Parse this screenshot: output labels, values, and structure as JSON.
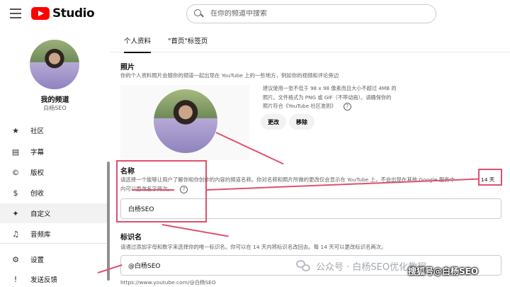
{
  "app": {
    "logo_text": "Studio"
  },
  "search": {
    "placeholder": "在你的频道中搜索"
  },
  "sidebar": {
    "channel_name": "我的频道",
    "channel_handle": "白杨SEO",
    "items": [
      {
        "label": "社区",
        "icon": "community-icon"
      },
      {
        "label": "字幕",
        "icon": "subtitles-icon"
      },
      {
        "label": "版权",
        "icon": "copyright-icon"
      },
      {
        "label": "创收",
        "icon": "monetization-icon"
      },
      {
        "label": "自定义",
        "icon": "customization-icon",
        "active": true
      },
      {
        "label": "音频库",
        "icon": "audio-library-icon"
      },
      {
        "label": "设置",
        "icon": "settings-icon"
      },
      {
        "label": "发送反馈",
        "icon": "feedback-icon"
      }
    ]
  },
  "tabs": [
    {
      "label": "个人资料",
      "active": true
    },
    {
      "label": "\"首页\"标签页",
      "active": false
    }
  ],
  "photo_section": {
    "title": "照片",
    "description": "你的个人资料照片会随你的频道一起出现在 YouTube 上的一些地方，例如你的视频和评论旁边",
    "hint_lines": [
      "建议使用一张不低于 98 x 98 像素而且大小不超过 4MB 的",
      "照片。文件格式为 PNG 或 GIF（不带动画）。请确保你的",
      "照片符合《YouTube 社区准则》"
    ],
    "change_label": "更改",
    "remove_label": "移除"
  },
  "name_section": {
    "title": "名称",
    "description_line1": "请选择一个能够让用户了解你和你创作的内容的频道名称。你对名称和照片所做的更改仅会显示在 YouTube 上，不会出现在其他 Google 服务中",
    "days_badge": "14 天",
    "description_line2": "内可以更改名字两次。",
    "value": "白杨SEO"
  },
  "handle_section": {
    "title": "标识名",
    "description": "请通过添加字母和数字来选择你的唯一标识名。你可以在 14 天内将标识名改回去。每 14 天可以更改标识名两次。",
    "value": "@白杨SEO",
    "url": "https://www.youtube.com/@白杨SEO"
  },
  "watermarks": {
    "wechat": "公众号 · 白杨SEO优化教程",
    "sohu": "搜狐号@白杨SEO"
  },
  "colors": {
    "brand_red": "#ff0000",
    "annotation": "#e0506e"
  }
}
